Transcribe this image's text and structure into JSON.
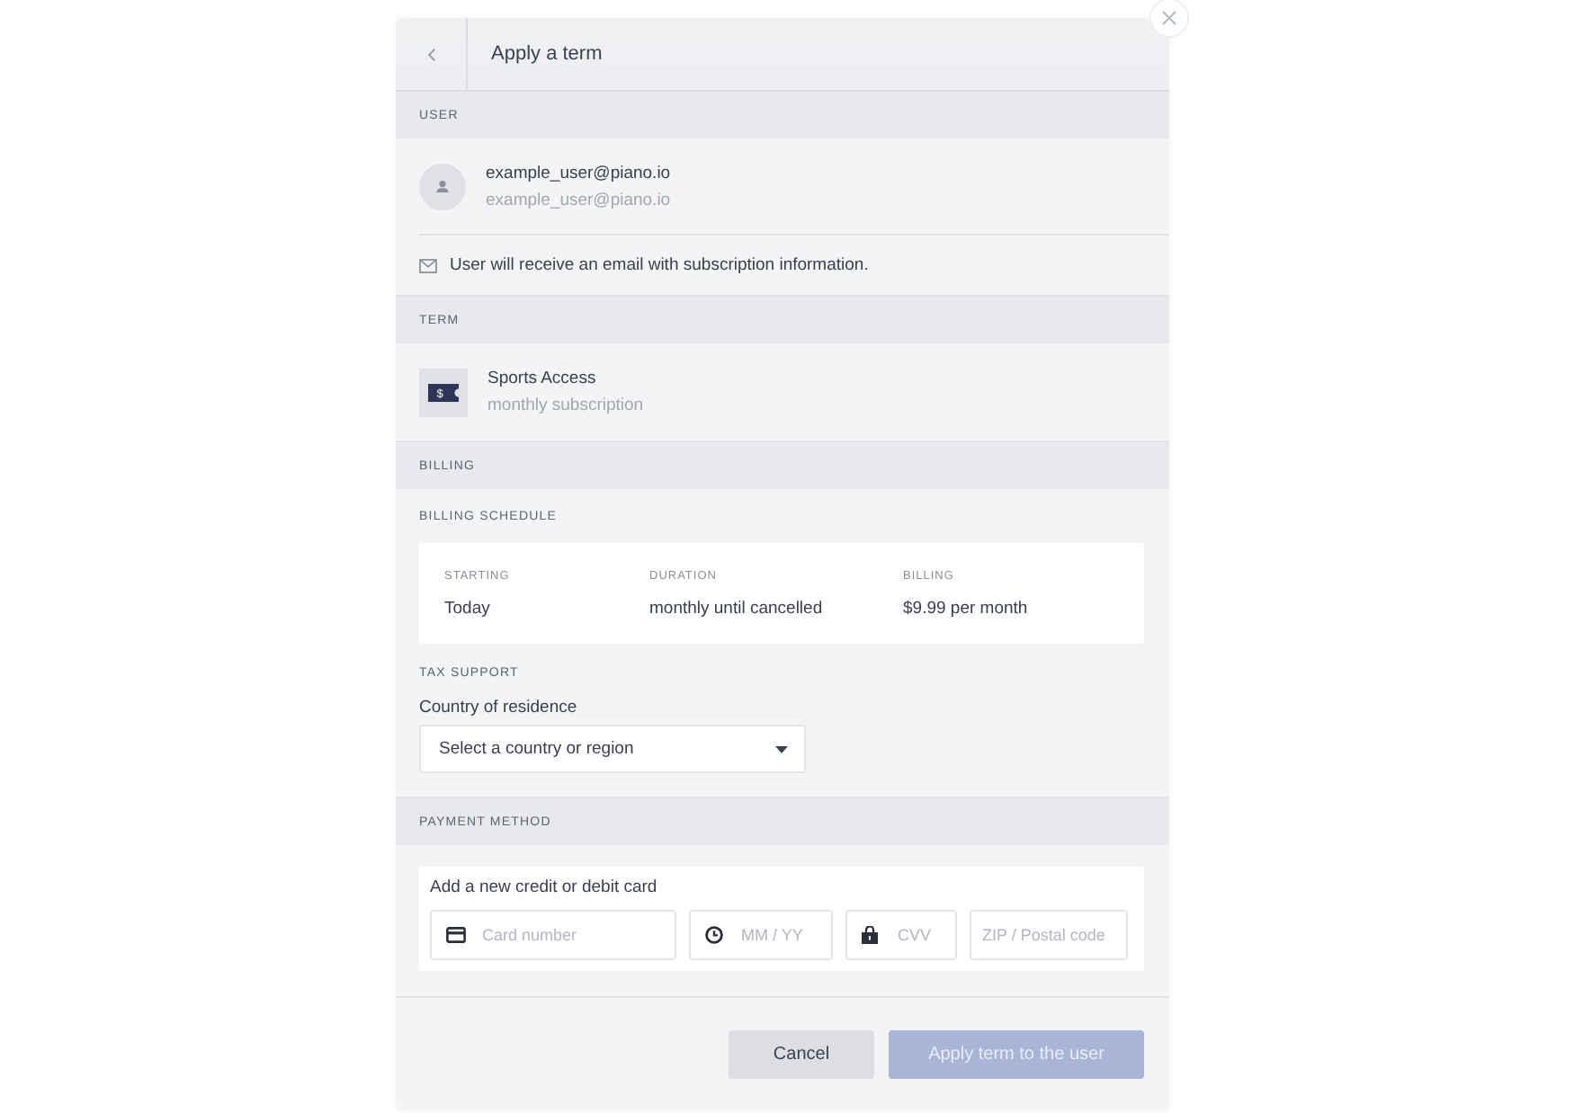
{
  "header": {
    "title": "Apply a term"
  },
  "user_section": {
    "heading": "USER",
    "name": "example_user@piano.io",
    "email": "example_user@piano.io",
    "note": "User will receive an email with subscription information."
  },
  "term_section": {
    "heading": "TERM",
    "symbol": "$",
    "name": "Sports Access",
    "description": "monthly subscription"
  },
  "billing_section": {
    "heading": "BILLING",
    "schedule_label": "BILLING SCHEDULE",
    "schedule": [
      {
        "label": "STARTING",
        "value": "Today"
      },
      {
        "label": "DURATION",
        "value": "monthly until cancelled"
      },
      {
        "label": "BILLING",
        "value": "$9.99 per month"
      }
    ],
    "tax_label": "TAX SUPPORT",
    "country_label": "Country of residence",
    "country_select": {
      "placeholder": "Select a country or region"
    }
  },
  "payment_section": {
    "heading": "PAYMENT METHOD",
    "card_title": "Add a new credit or debit card",
    "fields": [
      {
        "kind": "card",
        "placeholder": "Card number"
      },
      {
        "kind": "expiry",
        "placeholder": "MM / YY"
      },
      {
        "kind": "cvv",
        "placeholder": "CVV"
      },
      {
        "kind": "postal",
        "placeholder": "ZIP / Postal code"
      }
    ]
  },
  "buttons": [
    {
      "kind": "secondary",
      "label": "Cancel",
      "disabled": false
    },
    {
      "kind": "primary",
      "label": "Apply term to the user",
      "disabled": true
    }
  ]
}
